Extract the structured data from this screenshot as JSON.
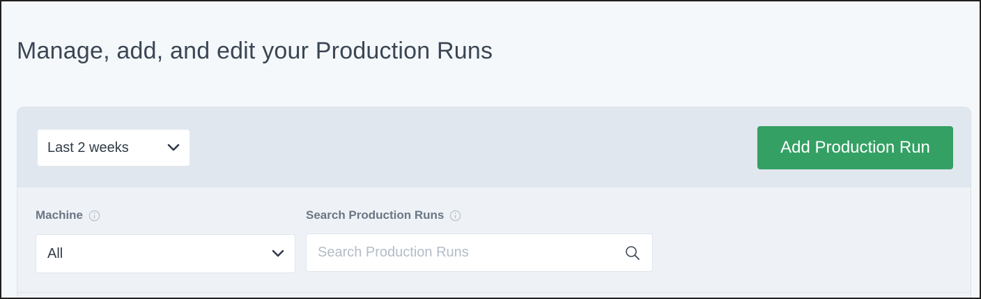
{
  "page": {
    "title": "Manage, add, and edit your Production Runs"
  },
  "toolbar": {
    "date_range": "Last 2 weeks",
    "add_button_label": "Add Production Run"
  },
  "filters": {
    "machine": {
      "label": "Machine",
      "value": "All"
    },
    "search": {
      "label": "Search Production Runs",
      "placeholder": "Search Production Runs",
      "value": ""
    }
  },
  "colors": {
    "accent": "#34a064",
    "text": "#3b4654",
    "panel_header": "#e1e7ef",
    "background": "#f5f8fb"
  },
  "icons": [
    "chevron-down-icon",
    "info-icon",
    "search-icon"
  ]
}
